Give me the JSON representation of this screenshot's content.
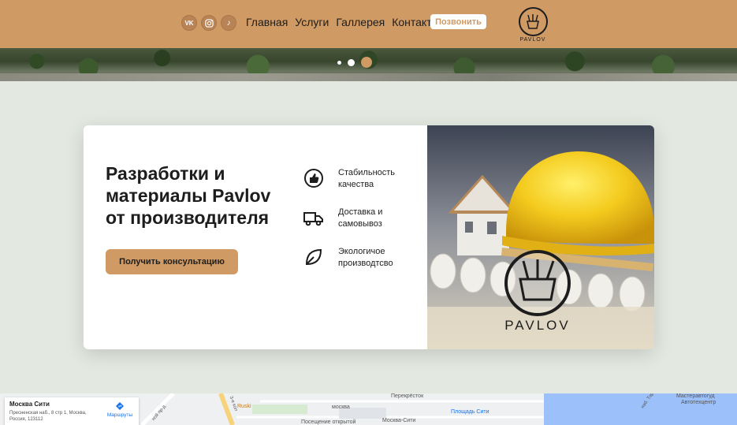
{
  "header": {
    "socials": [
      {
        "icon": "vk-icon",
        "glyph": "VK"
      },
      {
        "icon": "instagram-icon",
        "glyph": ""
      },
      {
        "icon": "tiktok-icon",
        "glyph": "♪"
      }
    ],
    "nav": [
      "Главная",
      "Услуги",
      "Галлерея",
      "Контакты"
    ],
    "call_label": "Позвонить",
    "logo_text": "PAVLOV",
    "accent": "#cf9a63"
  },
  "slider": {
    "dots": 3,
    "active_index": 2
  },
  "card": {
    "title": "Разработки и материалы Pavlov от производителя",
    "cta_label": "Получить консультацию",
    "features": [
      {
        "icon": "thumbs-up-icon",
        "text_line1": "Стабильность",
        "text_line2": "качества"
      },
      {
        "icon": "truck-icon",
        "text_line1": "Доставка и",
        "text_line2": "самовывоз"
      },
      {
        "icon": "leaf-icon",
        "text_line1": "Экологичое",
        "text_line2": "производтсво"
      }
    ],
    "photo_logo_text": "PAVLOV"
  },
  "map": {
    "place_title": "Москва Сити",
    "address": "Пресненская наб., 8 стр 1, Москва, Россия, 123112",
    "route_label": "Маршруты",
    "labels": [
      "Перекрёсток",
      "Мастеравтогуд",
      "Автотехцентр",
      "Ruski",
      "москва",
      "Площадь Сити",
      "Москва-Сити",
      "Посещение открытой",
      "3-е кол",
      "ной пр-д",
      "наб. Тар"
    ]
  }
}
